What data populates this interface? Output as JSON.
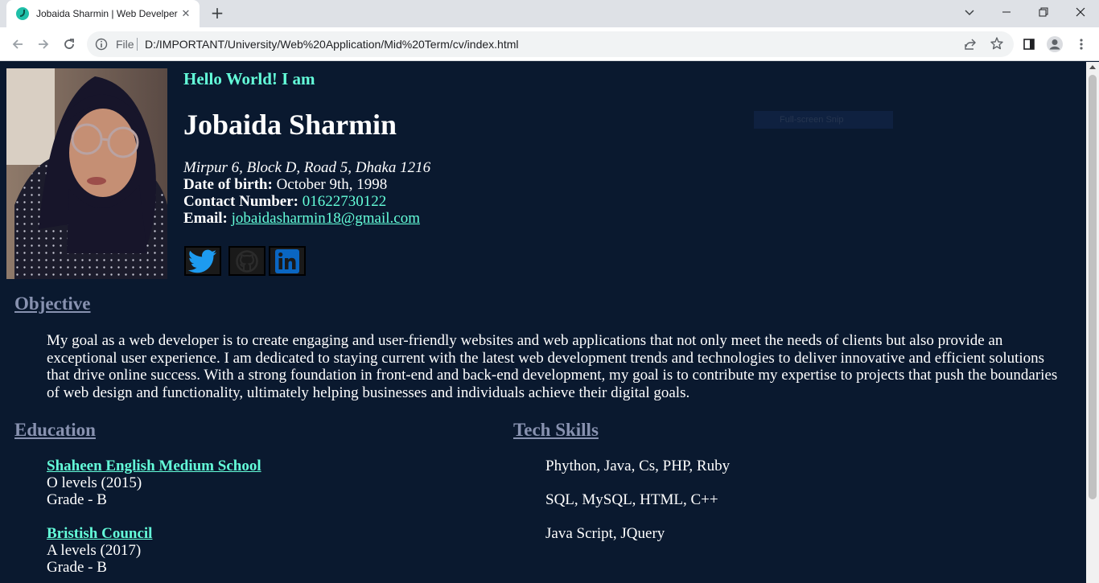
{
  "browser": {
    "tab_title": "Jobaida Sharmin | Web Develper",
    "url_scheme_label": "File",
    "url": "D:/IMPORTANT/University/Web%20Application/Mid%20Term/cv/index.html"
  },
  "header": {
    "greeting": "Hello World! I am",
    "name": "Jobaida Sharmin",
    "address": "Mirpur 6, Block D, Road 5, Dhaka 1216",
    "dob_label": "Date of birth:",
    "dob_value": "October 9th, 1998",
    "contact_label": "Contact Number:",
    "contact_value": "01622730122",
    "email_label": "Email:",
    "email_value": "jobaidasharmin18@gmail.com"
  },
  "social": [
    "twitter-icon",
    "github-icon",
    "linkedin-icon"
  ],
  "overlay": {
    "snip_label": "Full-screen Snip"
  },
  "objective": {
    "title": "Objective",
    "text": "My goal as a web developer is to create engaging and user-friendly websites and web applications that not only meet the needs of clients but also provide an exceptional user experience. I am dedicated to staying current with the latest web development trends and technologies to deliver innovative and efficient solutions that drive online success. With a strong foundation in front-end and back-end development, my goal is to contribute my expertise to projects that push the boundaries of web design and functionality, ultimately helping businesses and individuals achieve their digital goals."
  },
  "education": {
    "title": "Education",
    "items": [
      {
        "school": "Shaheen English Medium School",
        "level": "O levels (2015)",
        "grade": "Grade - B"
      },
      {
        "school": "Bristish Council",
        "level": "A levels (2017)",
        "grade": "Grade - B"
      }
    ]
  },
  "skills": {
    "title": "Tech Skills",
    "items": [
      "Phython, Java, Cs, PHP, Ruby",
      "SQL, MySQL, HTML, C++",
      "Java Script, JQuery"
    ]
  },
  "colors": {
    "page_bg": "#0a192f",
    "accent": "#64ffda",
    "section_title": "#8892b0",
    "text": "#ffffff"
  }
}
